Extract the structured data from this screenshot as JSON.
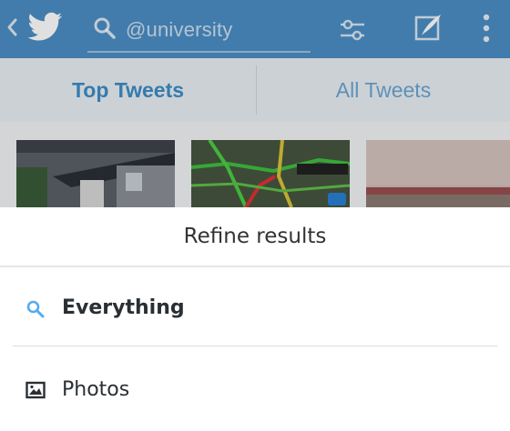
{
  "search": {
    "query": "@university"
  },
  "tabs": [
    {
      "label": "Top Tweets",
      "selected": true
    },
    {
      "label": "All Tweets",
      "selected": false
    }
  ],
  "refine": {
    "title": "Refine results",
    "options": [
      {
        "label": "Everything",
        "icon": "search-icon",
        "selected": true
      },
      {
        "label": "Photos",
        "icon": "image-icon",
        "selected": false
      }
    ]
  },
  "colors": {
    "appbar": "#4b8ec4",
    "accent": "#3d8cc6",
    "search_icon": "#55acee"
  },
  "icons": {
    "back": "chevron-left-icon",
    "logo": "twitter-bird-icon",
    "search": "search-icon",
    "filter": "filter-icon",
    "compose": "compose-icon",
    "more": "more-vertical-icon"
  }
}
